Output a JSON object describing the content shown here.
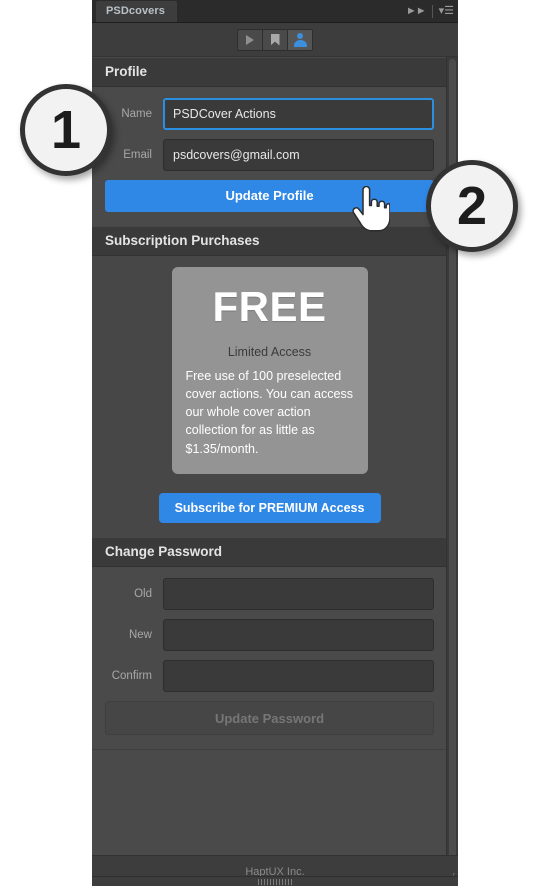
{
  "panel": {
    "tab_label": "PSDcovers",
    "collapse_icon": "double-chevron-right",
    "menu_icon": "panel-menu",
    "toolbar": [
      {
        "name": "play-button",
        "icon": "play-icon",
        "active": false
      },
      {
        "name": "bookmark-button",
        "icon": "bookmark-icon",
        "active": false
      },
      {
        "name": "account-button",
        "icon": "person-icon",
        "active": true
      }
    ],
    "footer_text": "HaptUX Inc."
  },
  "profile": {
    "header": "Profile",
    "name_label": "Name",
    "name_value": "PSDCover Actions",
    "name_placeholder": "Name",
    "email_label": "Email",
    "email_value": "psdcovers@gmail.com",
    "email_placeholder": "Email",
    "update_button": "Update Profile"
  },
  "subscription": {
    "header": "Subscription Purchases",
    "plan_title": "FREE",
    "plan_subtitle": "Limited Access",
    "plan_description": "Free use of 100 preselected cover actions. You can access our whole cover action collection for as little as $1.35/month.",
    "subscribe_button": "Subscribe for PREMIUM Access"
  },
  "change_password": {
    "header": "Change Password",
    "old_label": "Old",
    "old_value": "",
    "old_placeholder": "",
    "new_label": "New",
    "new_value": "",
    "new_placeholder": "",
    "confirm_label": "Confirm",
    "confirm_value": "",
    "confirm_placeholder": "",
    "update_button": "Update Password"
  },
  "callouts": [
    {
      "number": "1"
    },
    {
      "number": "2"
    }
  ],
  "colors": {
    "accent_blue": "#2f87e6",
    "focus_blue": "#2a8fe0",
    "panel_bg": "#3d3d3d",
    "section_bg": "#4a4a4a",
    "card_grey": "#949494"
  }
}
